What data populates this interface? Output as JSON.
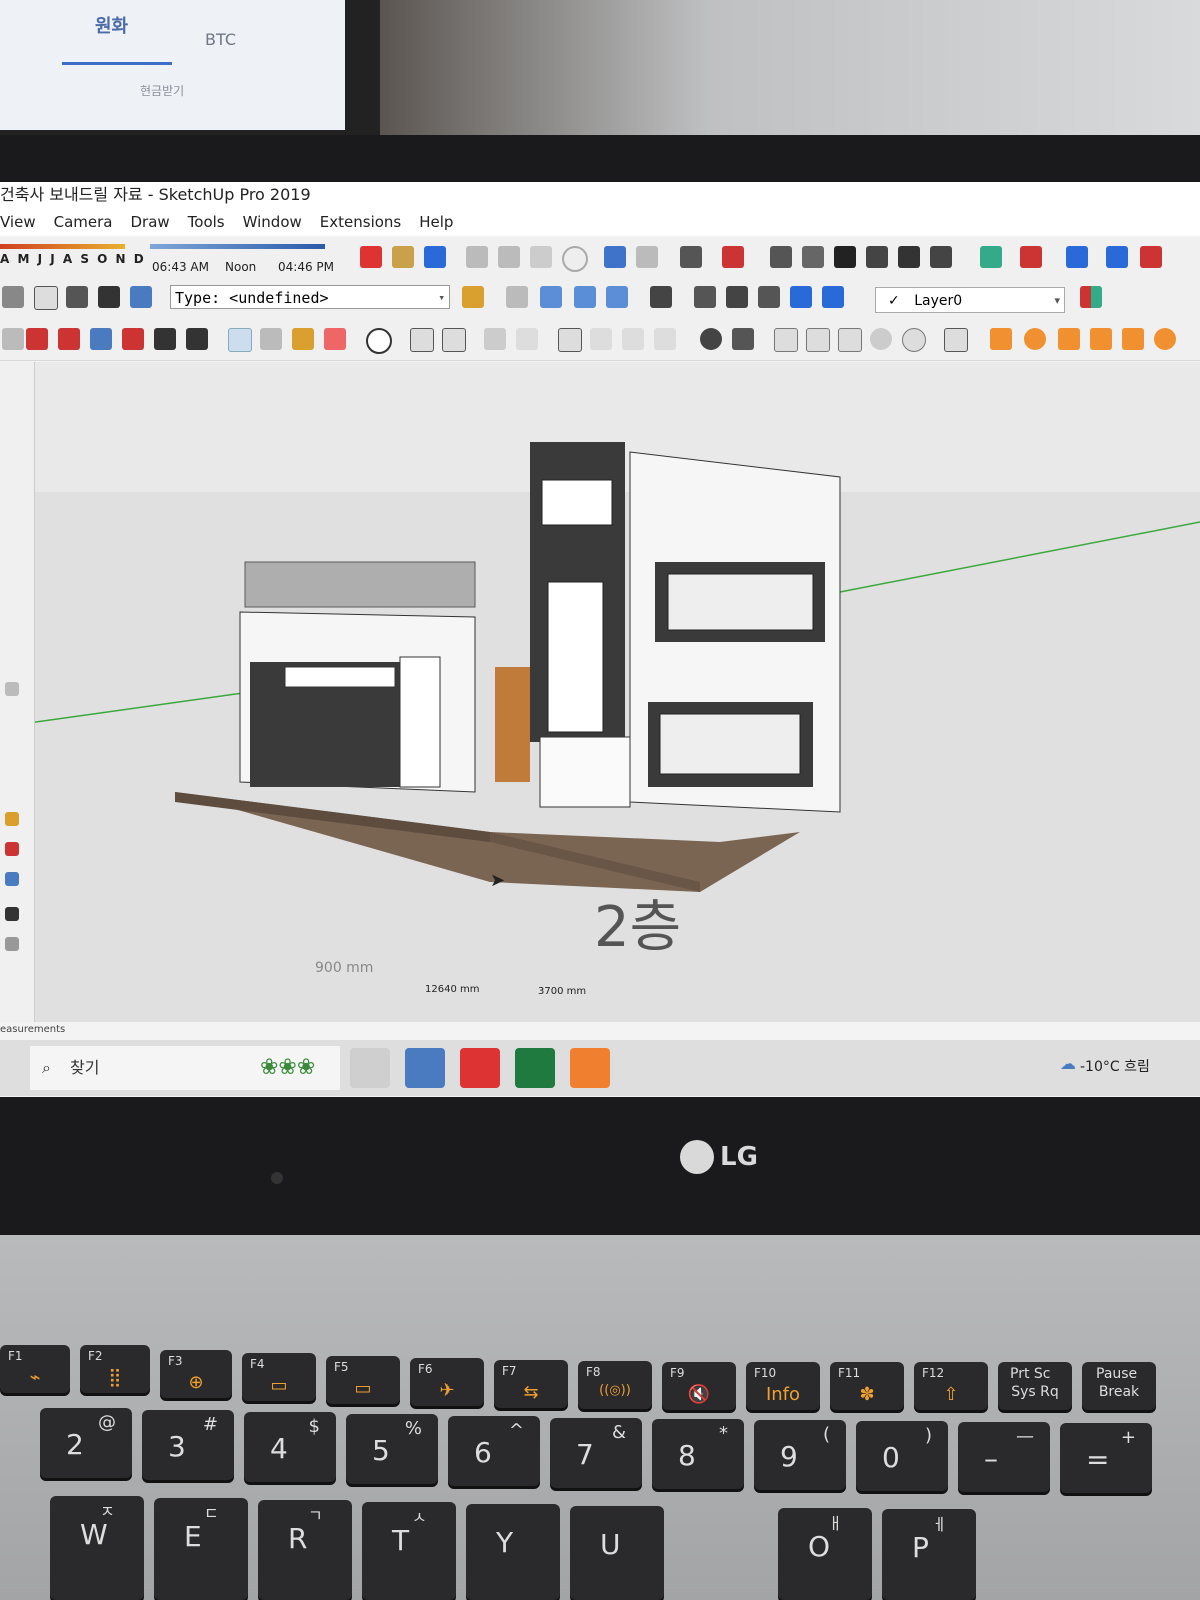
{
  "app": {
    "window_title": "건축사 보내드릴 자료 - SketchUp Pro 2019"
  },
  "menu": [
    "View",
    "Camera",
    "Draw",
    "Tools",
    "Window",
    "Extensions",
    "Help"
  ],
  "shadows": {
    "months": "A M J J A S O N D",
    "time_start": "06:43 AM",
    "time_mid": "Noon",
    "time_end": "04:46 PM"
  },
  "entity_info": {
    "type_label": "Type: <undefined>"
  },
  "layer": {
    "current": "Layer0",
    "check": "✓"
  },
  "dimensions": {
    "d1": "12640 mm",
    "d2": "3700 mm",
    "d3": "900 mm"
  },
  "model_label": "2층",
  "status": {
    "measurements_label": "easurements"
  },
  "taskbar": {
    "search_placeholder": "찾기",
    "weather": "-10°C 흐림"
  },
  "background_monitor": {
    "tab1": "원화",
    "tab2": "BTC",
    "line": "현금받기"
  },
  "brand": "LG",
  "keyboard": {
    "fkeys": [
      {
        "label": "F1",
        "glyph": "⌁"
      },
      {
        "label": "F2",
        "glyph": "⣿"
      },
      {
        "label": "F3",
        "glyph": "⊕"
      },
      {
        "label": "F4",
        "glyph": "▭"
      },
      {
        "label": "F5",
        "glyph": "▭"
      },
      {
        "label": "F6",
        "glyph": "✈"
      },
      {
        "label": "F7",
        "glyph": "⇆"
      },
      {
        "label": "F8",
        "glyph": "((◎))"
      },
      {
        "label": "F9",
        "glyph": "🔇"
      },
      {
        "label": "F10",
        "glyph": "Info"
      },
      {
        "label": "F11",
        "glyph": "✽"
      },
      {
        "label": "F12",
        "glyph": "⇧"
      },
      {
        "label": "Prt Sc",
        "glyph": "Sys Rq"
      },
      {
        "label": "Pause",
        "glyph": "Break"
      }
    ],
    "number_row": [
      {
        "n": "2",
        "s": "@"
      },
      {
        "n": "3",
        "s": "#"
      },
      {
        "n": "4",
        "s": "$"
      },
      {
        "n": "5",
        "s": "%"
      },
      {
        "n": "6",
        "s": "^"
      },
      {
        "n": "7",
        "s": "&"
      },
      {
        "n": "8",
        "s": "*"
      },
      {
        "n": "9",
        "s": "("
      },
      {
        "n": "0",
        "s": ")"
      },
      {
        "n": "–",
        "s": "—"
      },
      {
        "n": "=",
        "s": "+"
      }
    ],
    "letter_row": [
      {
        "n": "W",
        "k": "ㅈ"
      },
      {
        "n": "E",
        "k": "ㄷ"
      },
      {
        "n": "R",
        "k": "ㄱ"
      },
      {
        "n": "T",
        "k": "ㅅ"
      },
      {
        "n": "Y",
        "k": ""
      },
      {
        "n": "U",
        "k": ""
      },
      {
        "n": "O",
        "k": "ㅐ"
      },
      {
        "n": "P",
        "k": "ㅔ"
      }
    ]
  },
  "colors": {
    "accent_blue": "#2a6ad8",
    "house_dark": "#3a3a3a",
    "deck_wood": "#7a6452",
    "axis_green": "#3aa83a",
    "key_orange": "#f0a030"
  }
}
